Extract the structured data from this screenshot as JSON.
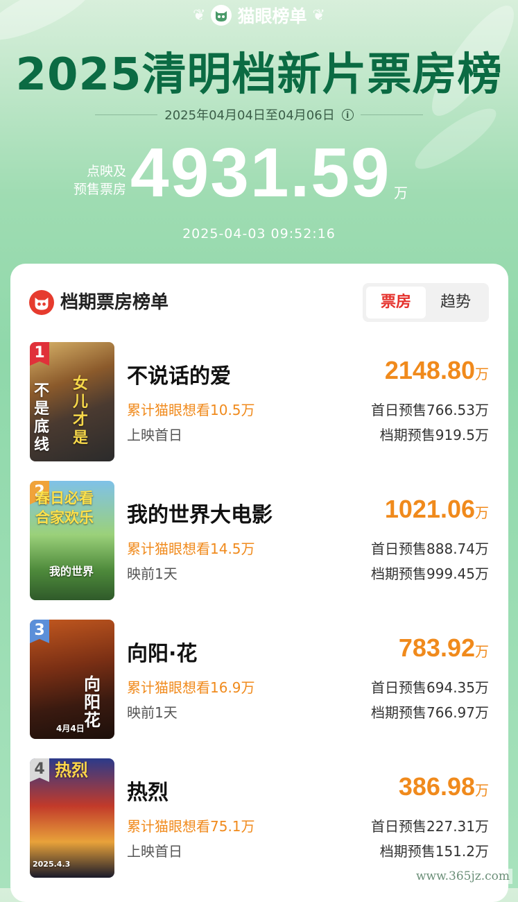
{
  "header": {
    "brand": "猫眼榜单",
    "title": "2025清明档新片票房榜",
    "date_range": "2025年04月04日至04月06日",
    "total_label_line1": "点映及",
    "total_label_line2": "预售票房",
    "total_value": "4931.59",
    "total_unit": "万",
    "timestamp": "2025-04-03  09:52:16"
  },
  "card": {
    "title": "档期票房榜单",
    "tabs": [
      {
        "label": "票房",
        "active": true
      },
      {
        "label": "趋势",
        "active": false
      }
    ]
  },
  "movies": [
    {
      "rank": "1",
      "name": "不说话的爱",
      "box_office": "2148.80",
      "unit": "万",
      "want_to_see": "累计猫眼想看10.5万",
      "status": "上映首日",
      "first_day_presale": "首日预售766.53万",
      "period_presale": "档期预售919.5万",
      "poster_text": [
        "不是底线",
        "女儿才是"
      ]
    },
    {
      "rank": "2",
      "name": "我的世界大电影",
      "box_office": "1021.06",
      "unit": "万",
      "want_to_see": "累计猫眼想看14.5万",
      "status": "映前1天",
      "first_day_presale": "首日预售888.74万",
      "period_presale": "档期预售999.45万",
      "poster_text": [
        "春日必看",
        "合家欢乐",
        "我的世界"
      ]
    },
    {
      "rank": "3",
      "name": "向阳·花",
      "box_office": "783.92",
      "unit": "万",
      "want_to_see": "累计猫眼想看16.9万",
      "status": "映前1天",
      "first_day_presale": "首日预售694.35万",
      "period_presale": "档期预售766.97万",
      "poster_text": [
        "向阳花",
        "4月4日"
      ]
    },
    {
      "rank": "4",
      "name": "热烈",
      "box_office": "386.98",
      "unit": "万",
      "want_to_see": "累计猫眼想看75.1万",
      "status": "上映首日",
      "first_day_presale": "首日预售227.31万",
      "period_presale": "档期预售151.2万",
      "poster_text": [
        "热烈",
        "2025.4.3"
      ]
    }
  ],
  "watermark": "www.365jz.com",
  "colors": {
    "accent_orange": "#f08a1c",
    "active_tab_red": "#e5322d",
    "title_green": "#0b6b43",
    "rank1": "#e0313a",
    "rank2": "#f0a33a",
    "rank3": "#5b8fd9",
    "rank4": "#d9d9d9"
  }
}
